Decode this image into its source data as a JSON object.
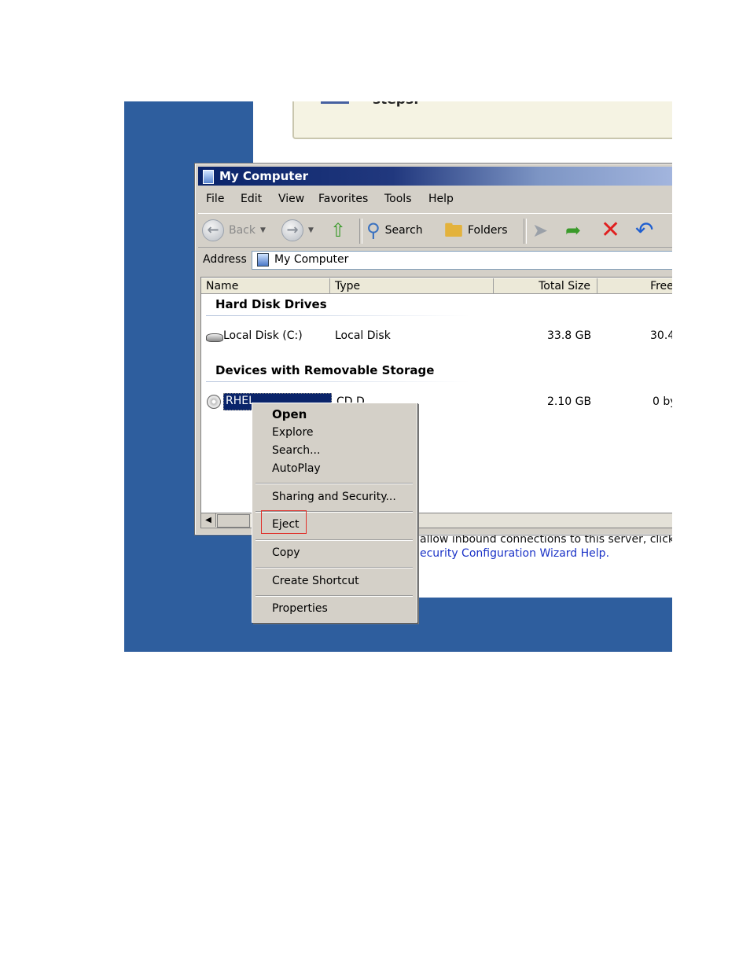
{
  "background": {
    "dialog_heading": "steps.",
    "info_line1": "allow inbound connections to this server, click Fir",
    "info_link": "ecurity Configuration Wizard Help."
  },
  "window": {
    "title": "My Computer",
    "menu": [
      "File",
      "Edit",
      "View",
      "Favorites",
      "Tools",
      "Help"
    ],
    "toolbar": {
      "back_label": "Back",
      "search_label": "Search",
      "folders_label": "Folders"
    },
    "address": {
      "label": "Address",
      "value": "My Computer"
    },
    "columns": [
      "Name",
      "Type",
      "Total Size",
      "Free Sp"
    ],
    "groups": {
      "hard_disk": "Hard Disk Drives",
      "removable": "Devices with Removable Storage"
    },
    "rows": [
      {
        "name": "Local Disk (C:)",
        "type": "Local Disk",
        "total": "33.8 GB",
        "free": "30.4"
      },
      {
        "name": "RHEL",
        "type": "CD D",
        "total": "2.10 GB",
        "free": "0 by"
      }
    ]
  },
  "context_menu": {
    "items": [
      "Open",
      "Explore",
      "Search...",
      "AutoPlay",
      "Sharing and Security...",
      "Eject",
      "Copy",
      "Create Shortcut",
      "Properties"
    ],
    "highlight_color": "#e0302a"
  },
  "colors": {
    "desktop": "#2e5e9e",
    "selection": "#0a246a",
    "link": "#1b33c7"
  }
}
